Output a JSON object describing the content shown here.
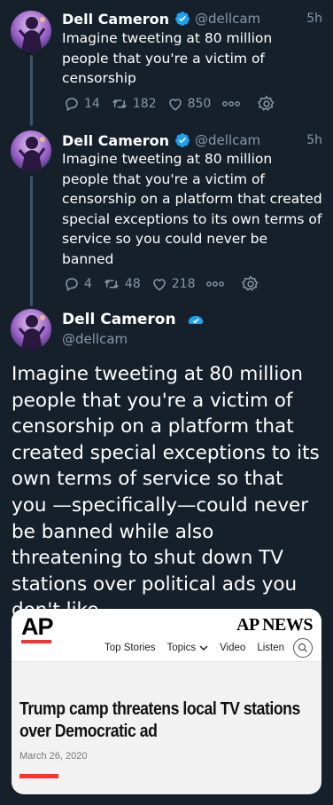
{
  "colors": {
    "background": "#15202b",
    "text": "#ffffff",
    "secondary": "#8899a6",
    "verified": "#1da1f2",
    "ap_red": "#ff322e"
  },
  "tweets": [
    {
      "name": "Dell Cameron",
      "handle": "@dellcam",
      "time": "5h",
      "text": "Imagine tweeting at 80 million people that you're a victim of censorship",
      "replies": "14",
      "retweets": "182",
      "likes": "850"
    },
    {
      "name": "Dell Cameron",
      "handle": "@dellcam",
      "time": "5h",
      "text": "Imagine tweeting at 80 million people that you're a victim of censorship on a platform that created special exceptions to its own terms of service so you could never be banned",
      "replies": "4",
      "retweets": "48",
      "likes": "218"
    }
  ],
  "main_tweet": {
    "name": "Dell Cameron",
    "handle": "@dellcam",
    "text": "Imagine tweeting at 80 million people that you're a victim of censorship on a platform that created special exceptions to its own terms of service so that you —specifically—could never be banned while also threatening to shut down TV stations over political ads you don't like"
  },
  "link_card": {
    "logo": "AP",
    "brand": "AP NEWS",
    "nav": [
      "Top Stories",
      "Topics",
      "Video",
      "Listen"
    ],
    "headline": "Trump camp threatens local TV stations over Democratic ad",
    "date": "March 26, 2020"
  },
  "icons": [
    "reply-icon",
    "retweet-icon",
    "like-icon",
    "more-icon",
    "settings-icon",
    "verified-icon",
    "search-icon",
    "chevron-down-icon"
  ]
}
